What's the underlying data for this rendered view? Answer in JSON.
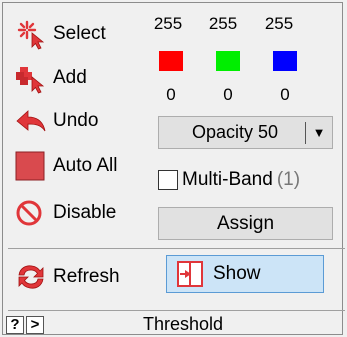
{
  "tools": {
    "select": "Select",
    "add": "Add",
    "undo": "Undo",
    "auto_all": "Auto All",
    "disable": "Disable",
    "refresh": "Refresh"
  },
  "levels": {
    "max": [
      "255",
      "255",
      "255"
    ],
    "min": [
      "0",
      "0",
      "0"
    ]
  },
  "swatch_colors": [
    "#ff0000",
    "#00ee00",
    "#0000ff"
  ],
  "opacity": {
    "label": "Opacity 50"
  },
  "multiband": {
    "label": "Multi-Band",
    "count": "(1)"
  },
  "assign_label": "Assign",
  "show_label": "Show",
  "footer": {
    "help": "?",
    "next": ">",
    "title": "Threshold"
  },
  "icons": {
    "select": "starburst-select-icon",
    "add": "add-blocks-icon",
    "undo": "undo-arrow-icon",
    "auto_all": "red-square-icon",
    "disable": "prohibit-icon",
    "refresh": "refresh-arrows-icon",
    "show": "show-panel-icon"
  }
}
